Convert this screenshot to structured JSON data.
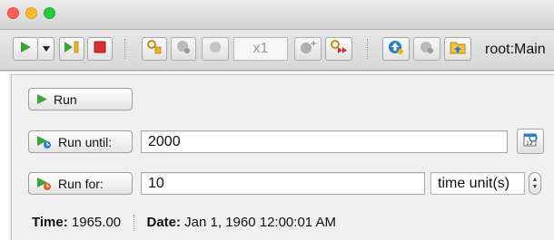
{
  "window": {
    "controls": [
      "close",
      "minimize",
      "maximize"
    ]
  },
  "toolbar": {
    "speed_label": "x1",
    "root_label": "root:Main",
    "icons": [
      "play-icon",
      "dropdown-arrow-icon",
      "step-icon",
      "stop-icon",
      "statechart-icon",
      "pause-circle-icon",
      "speed-down-icon",
      "speed-up-icon",
      "navigate-up-icon",
      "navigate-gray-icon",
      "folder-icon"
    ]
  },
  "run_panel": {
    "run_label": "Run",
    "run_until_label": "Run until:",
    "run_until_value": "2000",
    "run_for_label": "Run for:",
    "run_for_value": "10",
    "time_unit_label": "time unit(s)"
  },
  "status": {
    "time_label": "Time:",
    "time_value": "1965.00",
    "date_label": "Date:",
    "date_value": "Jan 1, 1960 12:00:01 AM"
  },
  "colors": {
    "play_green": "#3aa33a",
    "stop_red": "#d83030",
    "icon_yellow": "#e8b422",
    "icon_blue": "#2f7fc8"
  }
}
